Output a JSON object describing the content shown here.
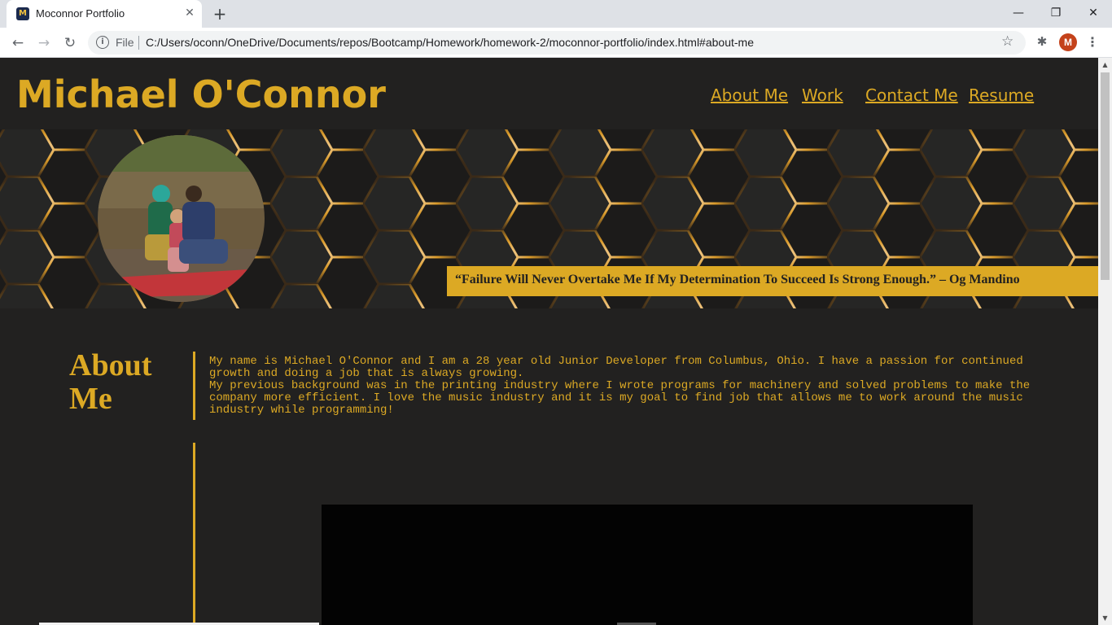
{
  "browser": {
    "tab_title": "Moconnor Portfolio",
    "favicon_letter": "M",
    "new_tab_symbol": "+",
    "close_symbol": "✕",
    "scheme_label": "File",
    "url": "C:/Users/oconn/OneDrive/Documents/repos/Bootcamp/Homework/homework-2/moconnor-portfolio/index.html#about-me",
    "profile_initial": "M",
    "window_controls": {
      "minimize": "—",
      "restore": "❐",
      "close": "✕"
    }
  },
  "header": {
    "title": "Michael O'Connor",
    "nav": [
      "About Me",
      "Work",
      "Contact Me",
      "Resume"
    ]
  },
  "hero": {
    "quote": "“Failure Will Never Overtake Me If My Determination To Succeed Is Strong Enough.” – Og Mandino"
  },
  "about": {
    "heading": "About Me",
    "paragraphs": [
      "My name is Michael O'Connor and I am a 28 year old Junior Developer from Columbus, Ohio. I have a passion for continued growth and doing a job that is always growing.",
      "My previous background was in the printing industry where I wrote programs for machinery and solved problems to make the company more efficient. I love the music industry and it is my goal to find job that allows me to work around the music industry while programming!"
    ]
  },
  "colors": {
    "accent": "#dca924",
    "background": "#222120",
    "hex_line": "#d99a2a"
  }
}
